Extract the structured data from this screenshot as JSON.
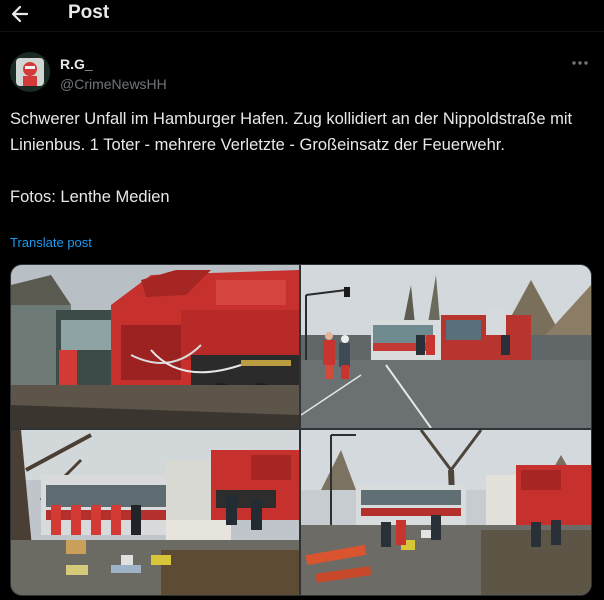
{
  "header": {
    "title": "Post",
    "back_icon": "arrow-left-icon"
  },
  "author": {
    "display_name": "R.G_",
    "handle": "@CrimeNewsHH"
  },
  "post": {
    "text": "Schwerer Unfall im Hamburger Hafen. Zug kollidiert an der Nippoldstraße mit Linienbus. 1 Toter - mehrere Verletzte - Großeinsatz der Feuerwehr.\n\nFotos: Lenthe Medien",
    "translate_label": "Translate post"
  },
  "media": {
    "count": 4,
    "photos": [
      "photo-train-bus-collision",
      "photo-firefighters-street",
      "photo-rescue-equipment",
      "photo-scene-overview"
    ]
  },
  "colors": {
    "background": "#000000",
    "text": "#e7e9ea",
    "muted": "#71767b",
    "link": "#1d9bf0",
    "train_red": "#c9302c"
  }
}
